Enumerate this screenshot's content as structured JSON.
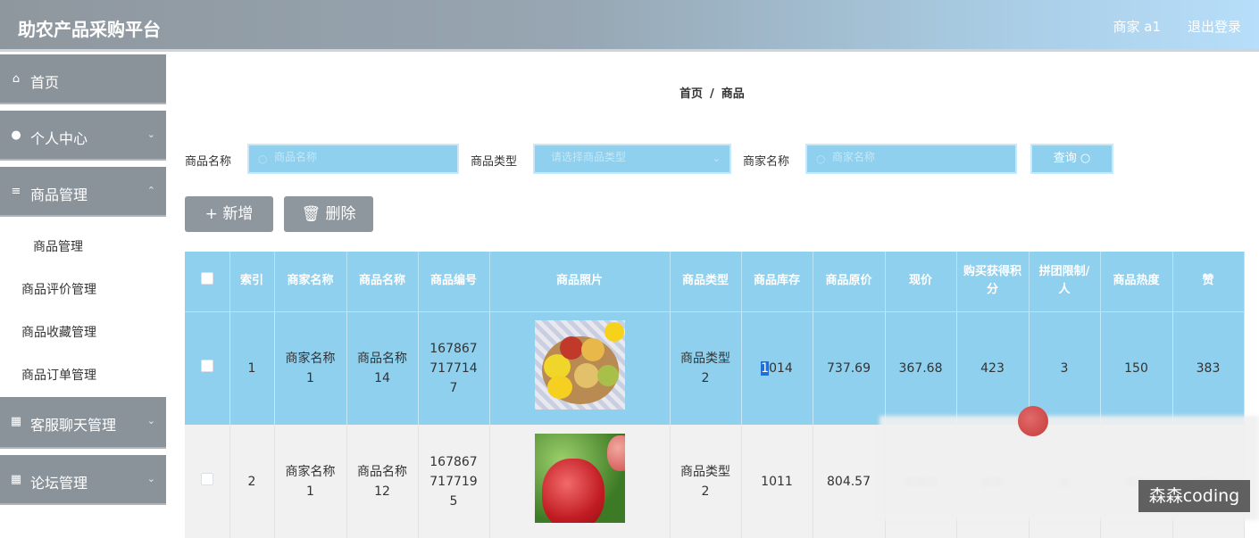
{
  "header": {
    "app_title": "助农产品采购平台",
    "user_label": "商家 a1",
    "logout_label": "退出登录"
  },
  "sidebar": {
    "items": [
      {
        "label": "首页",
        "icon": "home-icon"
      },
      {
        "label": "个人中心",
        "icon": "user-icon"
      },
      {
        "label": "商品管理",
        "icon": "menu-icon"
      },
      {
        "label": "客服聊天管理",
        "icon": "grid-icon"
      },
      {
        "label": "论坛管理",
        "icon": "grid-icon"
      }
    ],
    "sub_items": [
      "商品管理",
      "商品评价管理",
      "商品收藏管理",
      "商品订单管理"
    ]
  },
  "breadcrumb": {
    "home": "首页",
    "sep": "/",
    "current": "商品"
  },
  "search": {
    "name_label": "商品名称",
    "name_placeholder": "商品名称",
    "type_label": "商品类型",
    "type_placeholder": "请选择商品类型",
    "merchant_label": "商家名称",
    "merchant_placeholder": "商家名称",
    "query_label": "查询"
  },
  "actions": {
    "add_label": "新增",
    "delete_label": "删除"
  },
  "table": {
    "headers": [
      "索引",
      "商家名称",
      "商品名称",
      "商品编号",
      "商品照片",
      "商品类型",
      "商品库存",
      "商品原价",
      "现价",
      "购买获得积分",
      "拼团限制/人",
      "商品热度",
      "赞"
    ],
    "rows": [
      {
        "index": "1",
        "merchant": "商家名称1",
        "name": "商品名称14",
        "code": "1678677177147",
        "type": "商品类型2",
        "stock_hl": "1",
        "stock_rest": "014",
        "orig_price": "737.69",
        "price": "367.68",
        "points": "423",
        "limit": "3",
        "heat": "150",
        "likes": "383"
      },
      {
        "index": "2",
        "merchant": "商家名称1",
        "name": "商品名称12",
        "code": "1678677177195",
        "type": "商品类型2",
        "stock": "1011",
        "orig_price": "804.57"
      }
    ]
  },
  "watermark": "森森coding",
  "colors": {
    "header_gray": "#8f979e",
    "accent_blue": "#8fd0ee"
  }
}
